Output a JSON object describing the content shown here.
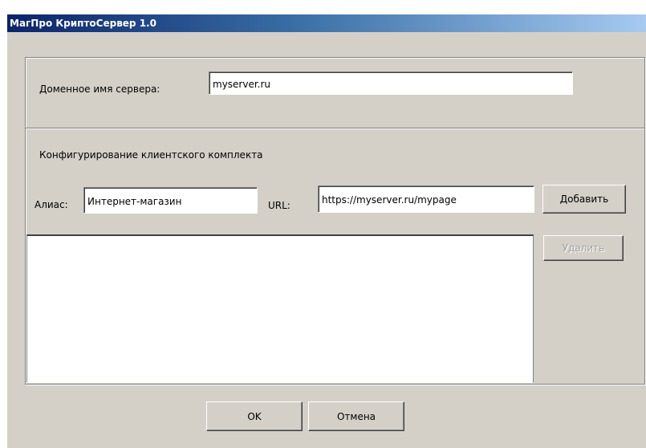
{
  "window": {
    "title": "МагПро КриптоСервер 1.0"
  },
  "server": {
    "domain_label": "Доменное имя сервера:",
    "domain_value": "myserver.ru"
  },
  "client_config": {
    "group_title": "Конфигурирование клиентского комплекта",
    "alias_label": "Алиас:",
    "alias_value": "Интернет-магазин",
    "url_label": "URL:",
    "url_value": "https://myserver.ru/mypage",
    "add_button": "Добавить",
    "delete_button": "Удалить",
    "delete_enabled": false,
    "list_items": []
  },
  "footer": {
    "ok_button": "OK",
    "cancel_button": "Отмена"
  },
  "colors": {
    "face": "#d4d0c8",
    "title_start": "#0a246a",
    "title_end": "#a6caf0",
    "disabled_text": "#a0a0a0"
  }
}
